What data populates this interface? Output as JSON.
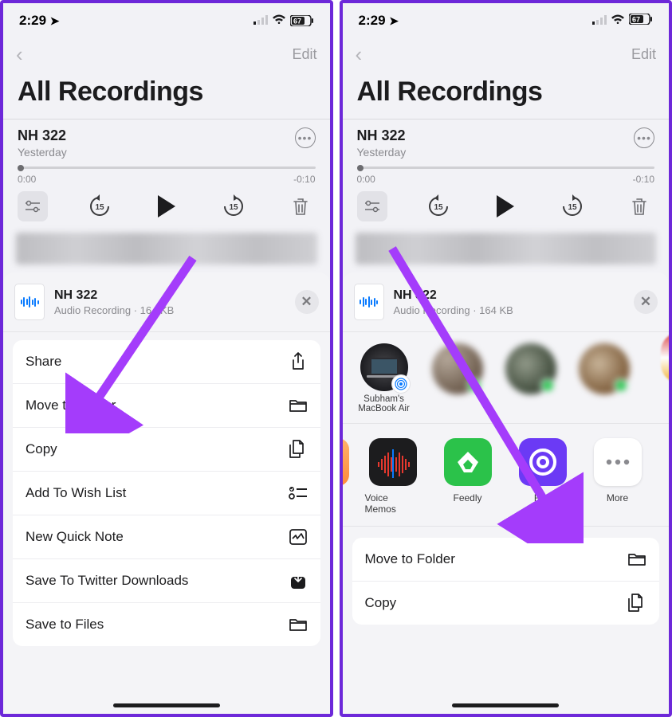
{
  "status": {
    "time": "2:29",
    "location_arrow": "↗",
    "battery": "67"
  },
  "nav": {
    "edit": "Edit"
  },
  "page_title": "All Recordings",
  "recording": {
    "title": "NH 322",
    "subtitle": "Yesterday",
    "start": "0:00",
    "end": "-0:10"
  },
  "sheet": {
    "file_title": "NH 322",
    "file_sub": "Audio Recording · 164 KB"
  },
  "actions_left": [
    {
      "label": "Share",
      "icon": "share"
    },
    {
      "label": "Move to Folder",
      "icon": "folder"
    },
    {
      "label": "Copy",
      "icon": "copy"
    },
    {
      "label": "Add To Wish List",
      "icon": "checklist"
    },
    {
      "label": "New Quick Note",
      "icon": "note"
    },
    {
      "label": "Save To Twitter Downloads",
      "icon": "download"
    },
    {
      "label": "Save to Files",
      "icon": "folder-open"
    }
  ],
  "airdrop": {
    "label_line1": "Subham's",
    "label_line2": "MacBook Air"
  },
  "apps": [
    {
      "label": "Voice Memos",
      "key": "voice"
    },
    {
      "label": "Feedly",
      "key": "feedly"
    },
    {
      "label": "Rev",
      "key": "rev"
    },
    {
      "label": "More",
      "key": "more"
    }
  ],
  "actions_right": [
    {
      "label": "Move to Folder",
      "icon": "folder"
    },
    {
      "label": "Copy",
      "icon": "copy"
    }
  ],
  "arrow_color": "#a43cfb"
}
